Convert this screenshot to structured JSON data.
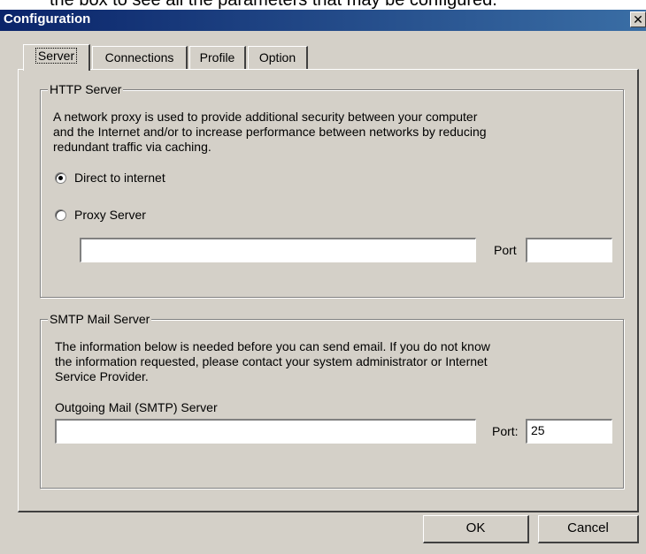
{
  "top_strip_text": "the box to see all the parameters that may be configured.",
  "dialog": {
    "title": "Configuration",
    "close_glyph": "✕"
  },
  "tabs": [
    {
      "label": "Server",
      "active": true
    },
    {
      "label": "Connections",
      "active": false
    },
    {
      "label": "Profile",
      "active": false
    },
    {
      "label": "Option",
      "active": false
    }
  ],
  "http": {
    "group_title": "HTTP Server",
    "description": [
      "A network proxy is used to provide additional security between your computer",
      "and the Internet and/or to increase performance between networks by reducing",
      "redundant traffic via caching."
    ],
    "option_direct": {
      "label": "Direct to internet",
      "selected": true
    },
    "option_proxy": {
      "label": "Proxy Server",
      "selected": false
    },
    "proxy_value": "",
    "port_label": "Port",
    "port_value": ""
  },
  "smtp": {
    "group_title": "SMTP Mail Server",
    "description": [
      "The information below is needed before you can send email. If you do not know",
      "the information requested, please contact your system administrator or Internet",
      "Service Provider."
    ],
    "outgoing_label": "Outgoing Mail (SMTP) Server",
    "outgoing_value": "",
    "port_label": "Port:",
    "port_value": "25"
  },
  "buttons": {
    "ok": "OK",
    "cancel": "Cancel"
  }
}
